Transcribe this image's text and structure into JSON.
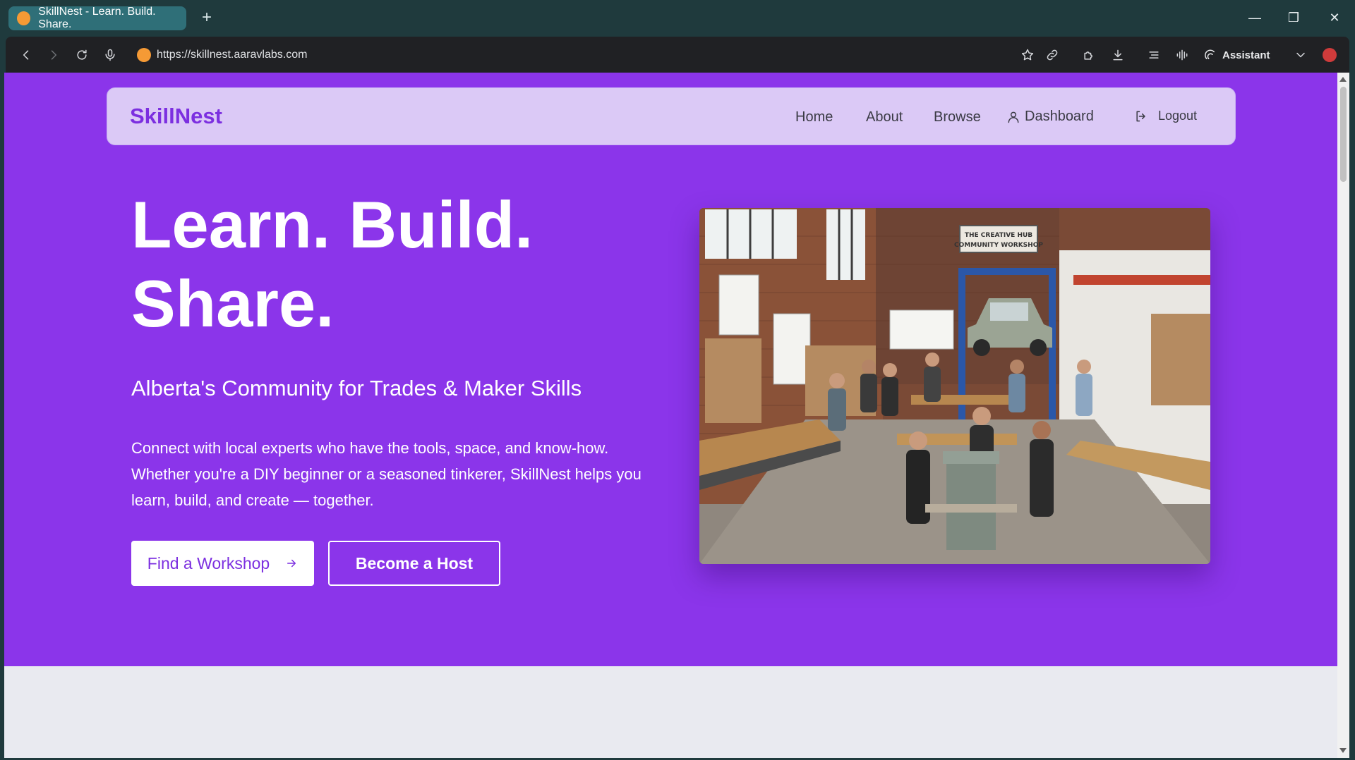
{
  "browser": {
    "tab_title": "SkillNest - Learn. Build. Share.",
    "url": "https://skillnest.aaravlabs.com",
    "assistant_label": "Assistant"
  },
  "site": {
    "brand": "SkillNest",
    "nav": {
      "home": "Home",
      "about": "About",
      "browse": "Browse",
      "dashboard": "Dashboard",
      "logout": "Logout"
    }
  },
  "hero": {
    "headline_line1": "Learn. Build.",
    "headline_line2": "Share.",
    "subheadline": "Alberta's Community for Trades & Maker Skills",
    "description": "Connect with local experts who have the tools, space, and know-how. Whether you're a DIY beginner or a seasoned tinkerer, SkillNest helps you learn, build, and create — together.",
    "primary_button": "Find a Workshop",
    "secondary_button": "Become a Host",
    "image_sign_line1": "THE CREATIVE HUB",
    "image_sign_line2": "COMMUNITY WORKSHOP"
  },
  "colors": {
    "hero_bg": "#8b35ea",
    "brand": "#7c2fe0",
    "navbar_bg": "#dbc9f6"
  }
}
